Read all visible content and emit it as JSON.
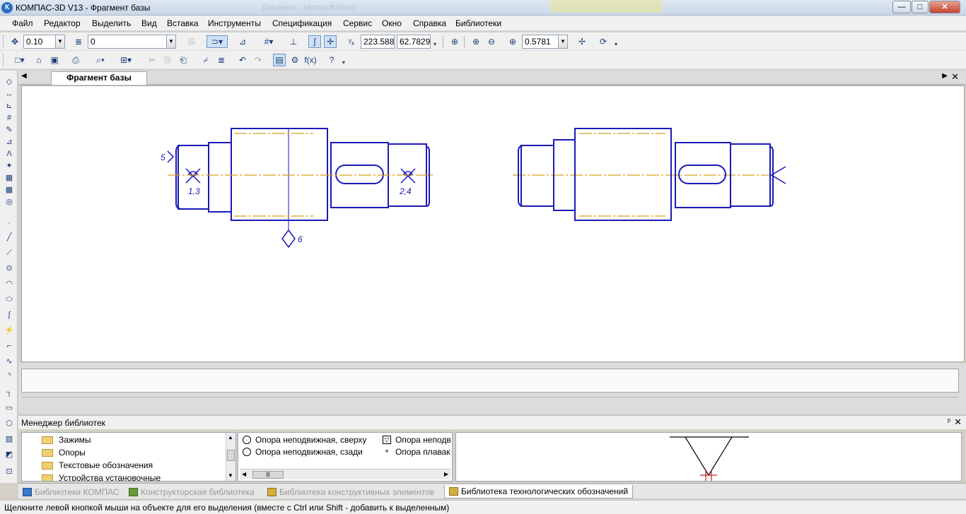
{
  "window": {
    "title": "КОМПАС-3D V13 - Фрагмент базы",
    "logo_text": "К",
    "ghost_tabs": [
      "Документ - Microsoft Word"
    ],
    "controls": {
      "minimize": "—",
      "maximize": "□",
      "close": "✕"
    }
  },
  "menu": [
    "Файл",
    "Редактор",
    "Выделить",
    "Вид",
    "Вставка",
    "Инструменты",
    "Спецификация",
    "Сервис",
    "Окно",
    "Справка",
    "Библиотеки"
  ],
  "toolbar1": {
    "step_value": "0.10",
    "layer_value": "0",
    "coord_x": "223.588",
    "coord_y": "62.7829",
    "zoom_value": "0.5781"
  },
  "document": {
    "tab_label": "Фрагмент базы"
  },
  "drawing": {
    "line_color": "#1a1ab8",
    "axis_color": "#d4a020",
    "labels": {
      "left_arrow": "5",
      "left_sym1": "1,3",
      "left_sym2": "2,4",
      "diamond": "6"
    }
  },
  "library_manager": {
    "title": "Менеджер библиотек",
    "pin": "ᵖ",
    "close": "✕",
    "tree": [
      "Зажимы",
      "Опоры",
      "Текстовые обозначения",
      "Устройства установочные"
    ],
    "list_col1": [
      "Опора неподвижная, сверху",
      "Опора неподвижная, сзади"
    ],
    "list_col2": [
      "Опора неподв",
      "Опора плавак"
    ],
    "tabs": [
      "Библиотеки КОМПАС",
      "Конструкторская библиотека",
      "Библиотека конструктивных элементов",
      "Библиотека технологических обозначений"
    ],
    "preview_color": "#c02020"
  },
  "status": {
    "text": "Щелкните левой кнопкой мыши на объекте для его выделения (вместе с Ctrl или Shift - добавить к выделенным)"
  },
  "icons": [
    "kompas-logo-icon",
    "new-doc-icon",
    "open-icon",
    "save-icon",
    "print-icon",
    "cut-icon",
    "copy-icon",
    "paste-icon",
    "undo-icon",
    "redo-icon",
    "zoom-icon",
    "pan-icon",
    "refresh-icon",
    "help-icon",
    "folder-icon",
    "close-icon"
  ]
}
